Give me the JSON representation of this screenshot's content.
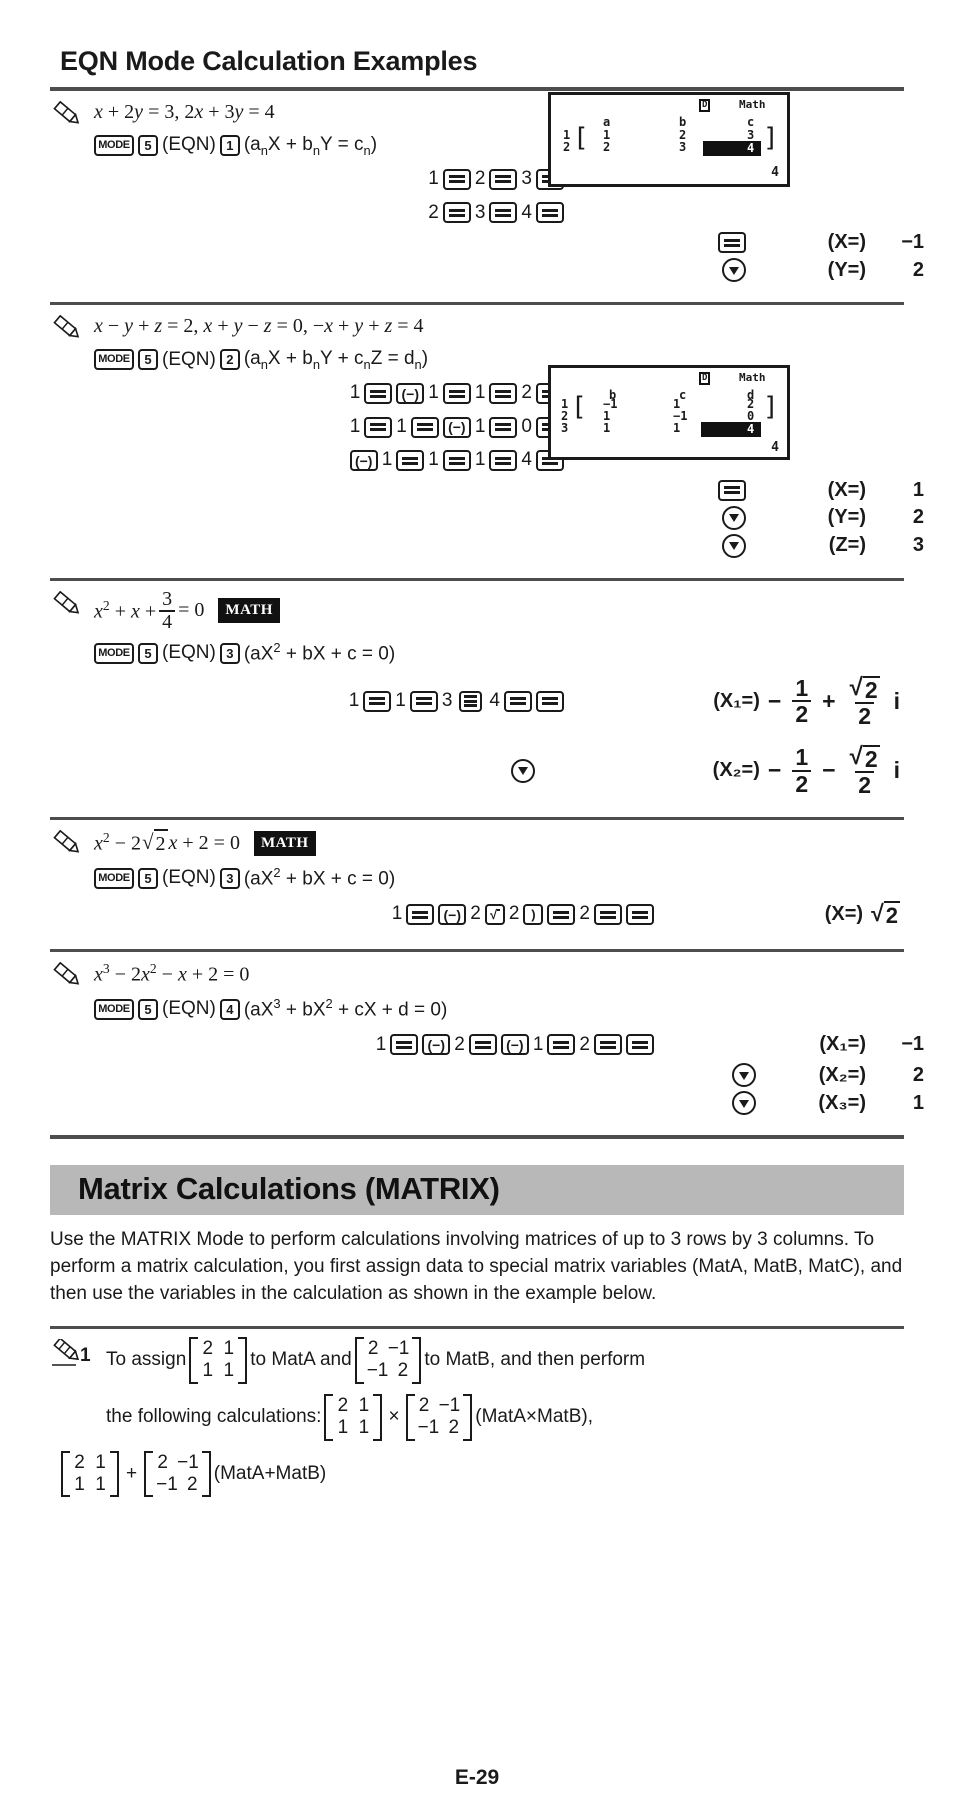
{
  "page": {
    "title": "EQN Mode Calculation Examples",
    "page_number": "E-29"
  },
  "examples": [
    {
      "id": "ex1",
      "equation_text": "x + 2y = 3, 2x + 3y = 4",
      "mode_keys": "MODE 5 (EQN) 1",
      "mode_label": "(EQN)",
      "mode_key": "MODE",
      "mode_num": "5",
      "sel_num": "1",
      "form": "(anX + bnY = cn)",
      "keyrows": [
        "1 = 2 = 3 =",
        "2 = 3 = 4 ="
      ],
      "results": [
        {
          "key": "=",
          "label": "(X=)",
          "value": "−1"
        },
        {
          "key": "down",
          "label": "(Y=)",
          "value": "2"
        }
      ],
      "lcd": {
        "indicator_d": "D",
        "indicator_math": "Math",
        "col_headers": [
          "a",
          "b",
          "c"
        ],
        "row_labels": [
          "1",
          "2"
        ],
        "cells": [
          [
            "1",
            "2",
            "3"
          ],
          [
            "2",
            "3",
            "4"
          ]
        ],
        "highlighted_cell": "4",
        "bottom_value": "4"
      }
    },
    {
      "id": "ex2",
      "equation_text": "x − y + z = 2, x + y − z = 0, −x + y + z = 4",
      "mode_key": "MODE",
      "mode_num": "5",
      "mode_label": "(EQN)",
      "sel_num": "2",
      "form": "(anX + bnY + cnZ = dn)",
      "keyrows": [
        "1 = (−) 1 = 1 = 2 =",
        "1 = 1 = (−) 1 = 0 =",
        "(−) 1 = 1 = 1 = 4 ="
      ],
      "results": [
        {
          "key": "=",
          "label": "(X=)",
          "value": "1"
        },
        {
          "key": "down",
          "label": "(Y=)",
          "value": "2"
        },
        {
          "key": "down",
          "label": "(Z=)",
          "value": "3"
        }
      ],
      "lcd": {
        "indicator_d": "D",
        "indicator_math": "Math",
        "col_headers": [
          "b",
          "c",
          "d"
        ],
        "row_labels": [
          "1",
          "2",
          "3"
        ],
        "cells": [
          [
            "−1",
            "1",
            "2"
          ],
          [
            "1",
            "−1",
            "0"
          ],
          [
            "1",
            "1",
            "4"
          ]
        ],
        "highlighted_cell": "4",
        "bottom_value": "4"
      }
    },
    {
      "id": "ex3",
      "equation_lhs": "x",
      "equation_text": "x² + x + 3/4 = 0",
      "badge": "MATH",
      "mode_key": "MODE",
      "mode_num": "5",
      "mode_label": "(EQN)",
      "sel_num": "3",
      "form": "(aX² + bX + c = 0)",
      "keyrows": [
        "1 = 1 = 3 ▤ 4 = ="
      ],
      "results": [
        {
          "key": "",
          "label": "(X₁=)",
          "value": "−1/2 + √2/2 i"
        },
        {
          "key": "down",
          "label": "(X₂=)",
          "value": "−1/2 − √2/2 i"
        }
      ]
    },
    {
      "id": "ex4",
      "equation_text": "x² − 2√2 x + 2 = 0",
      "badge": "MATH",
      "mode_key": "MODE",
      "mode_num": "5",
      "mode_label": "(EQN)",
      "sel_num": "3",
      "form": "(aX² + bX + c = 0)",
      "keyrows": [
        "1 = (−) 2 √ 2 ) = 2 = ="
      ],
      "results": [
        {
          "key": "",
          "label": "(X=)",
          "value": "√2"
        }
      ]
    },
    {
      "id": "ex5",
      "equation_text": "x³ − 2x² − x + 2 = 0",
      "mode_key": "MODE",
      "mode_num": "5",
      "mode_label": "(EQN)",
      "sel_num": "4",
      "form": "(aX³ + bX² + cX + d = 0)",
      "keyrows": [
        "1 = (−) 2 = (−) 1 = 2 = ="
      ],
      "results": [
        {
          "key": "",
          "label": "(X₁=)",
          "value": "−1"
        },
        {
          "key": "down",
          "label": "(X₂=)",
          "value": "2"
        },
        {
          "key": "down",
          "label": "(X₃=)",
          "value": "1"
        }
      ]
    }
  ],
  "matrix_section": {
    "heading": "Matrix Calculations (MATRIX)",
    "paragraph": "Use the MATRIX Mode to perform calculations involving matrices of up to 3 rows by 3 columns. To perform a matrix calculation, you first assign data to special matrix variables (MatA, MatB, MatC), and then use the variables in the calculation as shown in the example below.",
    "example_number": "1",
    "line1_a": "To assign",
    "line1_b": "to MatA and",
    "line1_c": "to MatB, and then perform",
    "line2_a": "the following calculations:",
    "line2_op": "×",
    "line2_note": "(MatA×MatB),",
    "line3_op": "+",
    "line3_note": "(MatA+MatB)",
    "matA": [
      [
        "2",
        "1"
      ],
      [
        "1",
        "1"
      ]
    ],
    "matB": [
      [
        "2",
        "−1"
      ],
      [
        "−1",
        "2"
      ]
    ]
  },
  "labels": {
    "key_mode": "MODE",
    "key_equals": "=",
    "key_neg": "(−)",
    "key_frac": "a b/c",
    "key_sqrt": "√",
    "key_paren_close": ")",
    "eqn_label": "(EQN)"
  }
}
